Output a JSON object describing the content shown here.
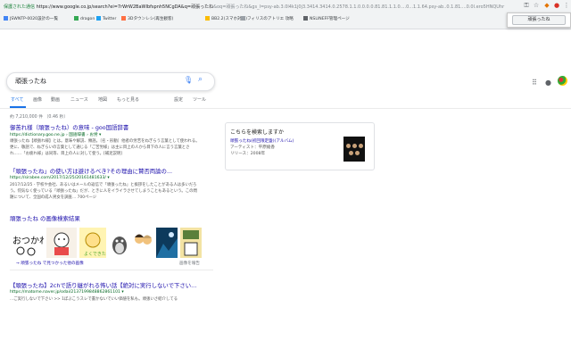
{
  "browser": {
    "url_secure": "保護された通信",
    "url_main": "https://www.google.co.jp/search?ei=7rWrW2BaWIbfspnh5NCgDA&q=",
    "url_query": "頑張ったね",
    "url_rest": "&oq=頑張ったね&gs_l=psy-ab.3.0l4k1j0j3.3414.3414.0.2578.1.1.0.0.0.0.81.81.1.1.0....0...1.1.64.psy-ab..0.1.81....0.0l.ero5HNQUhr",
    "bookmarks": [
      "JSWNTP-0020設計の一覧",
      "dragon",
      "Twitter",
      "3Dタウンレシ(再生観客)",
      "BB2.2(スマホ対応)",
      "フィリスのアトリエ 攻略",
      "NSLINEFF管理ページ"
    ],
    "popup_button": "頑張ったね"
  },
  "google": {
    "query": "頑張ったね",
    "tabs": [
      "すべて",
      "画像",
      "動画",
      "ニュース",
      "地図",
      "もっと見る",
      "設定",
      "ツール"
    ],
    "stats": "約 7,210,000 件 （0.46 秒）"
  },
  "results": [
    {
      "title": "御苦れ様（頑張ったね）の意味 - goo国語辞書",
      "url": "https://dictionary.goo.ne.jp › 国語辞書 › お労 ▾",
      "snippet": "頑張ったね【頑張れ様】とは。意味や解説、類語。〔名・形動〕他者の労苦をねぎらう言葉として使われる。更に、敬語で、ねぎらいの言葉として通じる「ご苦労様」は主に目上の人から目下の人に言う言葉とされ……「お疲れ様」は同等、目上の人に対して使う。[補足説明]"
    },
    {
      "title": "「頑張ったね」の使い方は避けるべき?その理由に賛否両論の...",
      "url": "https://sirabee.com/2017/12/25/20161481633/ ▾",
      "snippet": "2017/12/25 - 学校や会社、あるいはメールの返信で「頑張ったね」と挨拶をしたことがある人は多いだろう。何気なく使っている「頑張ったね」だが、ときに人をイライラさせてしまうこともあるという。この問題について、全国の成人男女を調査… 700ページ"
    }
  ],
  "card": {
    "heading": "こちらを検索しますか",
    "title": "頑張ったね(初回限定盤)(アルバム)",
    "artist": "アーティスト：",
    "artist_name": "平原綾香",
    "release": "リリース：",
    "release_year": "2008年"
  },
  "images": {
    "heading": "頑張ったね の画像検索結果",
    "link": "→ 頑張ったね で見つかった他の画像",
    "report": "画像を報告"
  },
  "result3": {
    "title": "【頑張ったね】2chで語り継がれる怖い話【絶対に実行しないで下さい...",
    "url": "https://matome.naver.jp/odai/2137199848862861101 ▾",
    "snippet": "...ご実行しないで下さい >> 1ぼぶこうスレで書かないでいい価値を私も。頑張いさ紹介してる"
  }
}
